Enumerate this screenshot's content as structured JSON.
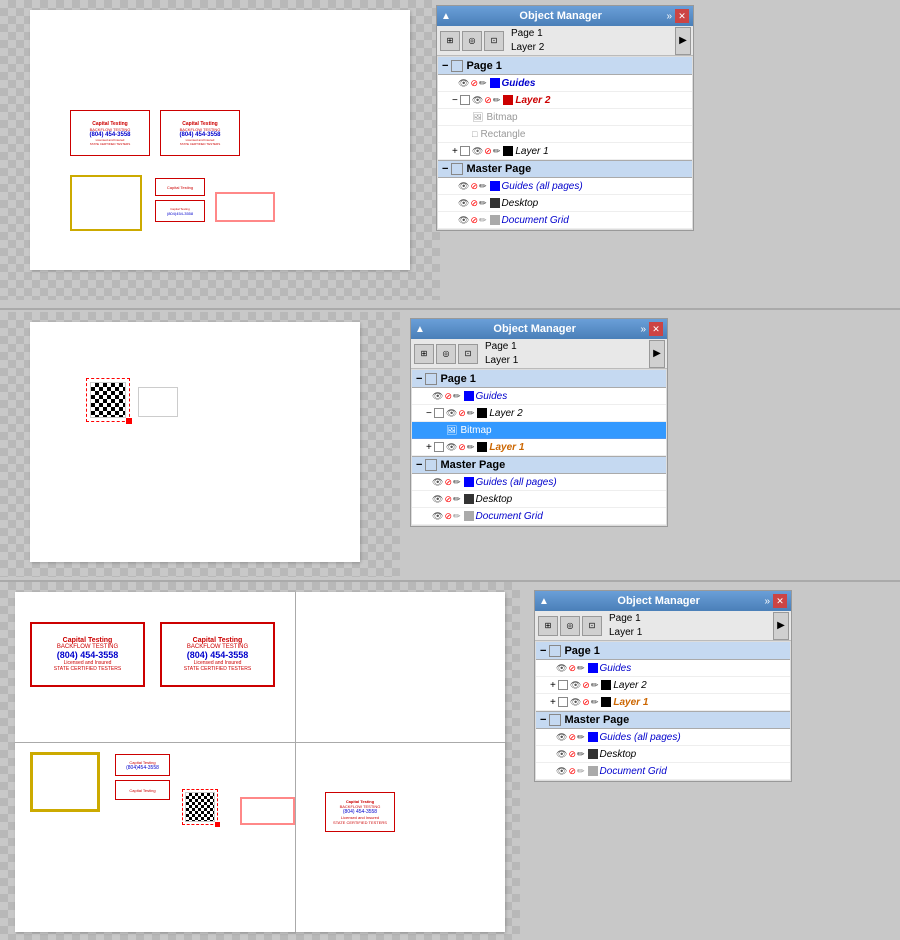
{
  "sections": [
    {
      "id": "top",
      "panel": {
        "title": "Object Manager",
        "toolbar": {
          "page_info": [
            "Page 1",
            "Layer 2"
          ]
        },
        "tree": {
          "page1_header": "Page 1",
          "items": [
            {
              "label": "Guides",
              "color": "blue",
              "indent": 1,
              "style": "italic-blue"
            },
            {
              "label": "Layer 2",
              "color": "red",
              "indent": 1,
              "style": "bold-red",
              "expanded": true
            },
            {
              "label": "Bitmap",
              "indent": 2,
              "style": "normal-gray"
            },
            {
              "label": "Rectangle",
              "indent": 2,
              "style": "normal-gray"
            },
            {
              "label": "Layer 1",
              "indent": 1,
              "style": "normal-black"
            }
          ],
          "master_header": "Master Page",
          "master_items": [
            {
              "label": "Guides (all pages)",
              "color": "blue",
              "indent": 1,
              "style": "italic-blue"
            },
            {
              "label": "Desktop",
              "indent": 1,
              "style": "normal-black"
            },
            {
              "label": "Document Grid",
              "indent": 1,
              "style": "italic-blue"
            }
          ]
        }
      }
    },
    {
      "id": "middle",
      "panel": {
        "title": "Object Manager",
        "toolbar": {
          "page_info": [
            "Page 1",
            "Layer 1"
          ]
        },
        "tree": {
          "page1_header": "Page 1",
          "items": [
            {
              "label": "Guides",
              "color": "blue",
              "indent": 1,
              "style": "italic-blue"
            },
            {
              "label": "Layer 2",
              "indent": 1,
              "style": "normal-black",
              "expanded": true
            },
            {
              "label": "Bitmap",
              "indent": 2,
              "style": "normal-black",
              "selected": true
            },
            {
              "label": "Layer 1",
              "indent": 1,
              "style": "bold-orange"
            }
          ],
          "master_header": "Master Page",
          "master_items": [
            {
              "label": "Guides (all pages)",
              "color": "blue",
              "indent": 1,
              "style": "italic-blue"
            },
            {
              "label": "Desktop",
              "indent": 1,
              "style": "normal-black"
            },
            {
              "label": "Document Grid",
              "indent": 1,
              "style": "italic-blue"
            }
          ]
        }
      }
    },
    {
      "id": "bottom",
      "panel": {
        "title": "Object Manager",
        "toolbar": {
          "page_info": [
            "Page 1",
            "Layer 1"
          ]
        },
        "tree": {
          "page1_header": "Page 1",
          "items": [
            {
              "label": "Guides",
              "color": "blue",
              "indent": 1,
              "style": "italic-blue"
            },
            {
              "label": "Layer 2",
              "indent": 1,
              "style": "normal-black"
            },
            {
              "label": "Layer 1",
              "indent": 1,
              "style": "bold-orange"
            }
          ],
          "master_header": "Master Page",
          "master_items": [
            {
              "label": "Guides (all pages)",
              "color": "blue",
              "indent": 1,
              "style": "italic-blue"
            },
            {
              "label": "Desktop",
              "indent": 1,
              "style": "normal-black"
            },
            {
              "label": "Document Grid",
              "indent": 1,
              "style": "italic-blue"
            }
          ]
        }
      }
    }
  ],
  "labels": {
    "capital_testing": "Capital Testing",
    "backflow_testing": "BACKFLOW TESTING",
    "phone": "(804) 454-3558",
    "licensed": "Licensed and Insured",
    "state_cert": "STATE CERTIFIED TESTERS",
    "bitmap": "Bitmap",
    "rectangle": "Rectangle",
    "expand_char": "−",
    "collapse_char": "+",
    "arrow_right": "▶",
    "arrow_collapse": "▲"
  },
  "colors": {
    "panel_header": "#4a7fb8",
    "tree_section": "#c5d9f1",
    "selected_bitmap": "#3399ff",
    "red_layer": "#cc0000",
    "blue_label": "#0000cc",
    "orange_layer": "#cc6600"
  }
}
